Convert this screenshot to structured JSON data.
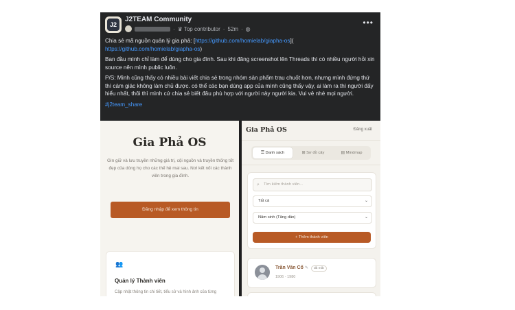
{
  "post": {
    "group_name": "J2TEAM Community",
    "badge": "Top contributor",
    "time": "52m",
    "more_icon": "more-dots-icon",
    "line1_text": "Chia sẻ mã nguồn quản lý gia phả: [",
    "line1_link": "https://github.com/homielab/giapha-os",
    "line1_end": "](",
    "line2_link": "https://github.com/homielab/giapha-os",
    "line2_end": ")",
    "paragraph2": "Ban đầu mình chỉ làm để dùng cho gia đình. Sau khi đăng screenshot lên Threads thì có nhiều người hỏi xin source nên mình public luôn.",
    "paragraph3": "P/S: Mình cũng thấy có nhiều bài viết chia sẻ trong nhóm sản phẩm trau chuốt hơn, nhưng mình đứng thứ thì cảm giác không làm chủ được. có thể các bạn dùng app của mình cũng thấy vậy, ai làm ra thì người đấy hiểu nhất, thôi thì mình cứ chia sẻ biết đâu phù hợp với người này người kia. Vui vẻ nhé mọi người.",
    "hashtag": "#j2team_share"
  },
  "left_screen": {
    "title": "Gia Phả OS",
    "description": "Gìn giữ và lưu truyền những giá trị, cội nguồn và truyền thống tốt đẹp của dòng họ cho các thế hệ mai sau. Nơi kết nối các thành viên trong gia đình.",
    "login_button": "Đăng nhập để xem thông tin",
    "card_title": "Quản lý Thành viên",
    "card_desc": "Cập nhật thông tin chi tiết, tiểu sử và hình ảnh của từng"
  },
  "right_screen": {
    "title": "Gia Phả OS",
    "logout": "Đăng xuất",
    "tabs": [
      {
        "label": "Danh sách",
        "icon": "list-icon",
        "active": true
      },
      {
        "label": "Sơ đồ cây",
        "icon": "tree-icon",
        "active": false
      },
      {
        "label": "Mindmap",
        "icon": "mindmap-icon",
        "active": false
      }
    ],
    "search_placeholder": "Tìm kiếm thành viên...",
    "filter_value": "Tất cả",
    "sort_value": "Năm sinh (Tăng dần)",
    "add_button": "+ Thêm thành viên",
    "members": [
      {
        "name": "Trần Văn Cố",
        "tag": "đã mất",
        "years": "1906 - 1980"
      }
    ]
  },
  "colors": {
    "post_bg": "#242526",
    "link": "#4599ff",
    "accent": "#b85a25"
  }
}
